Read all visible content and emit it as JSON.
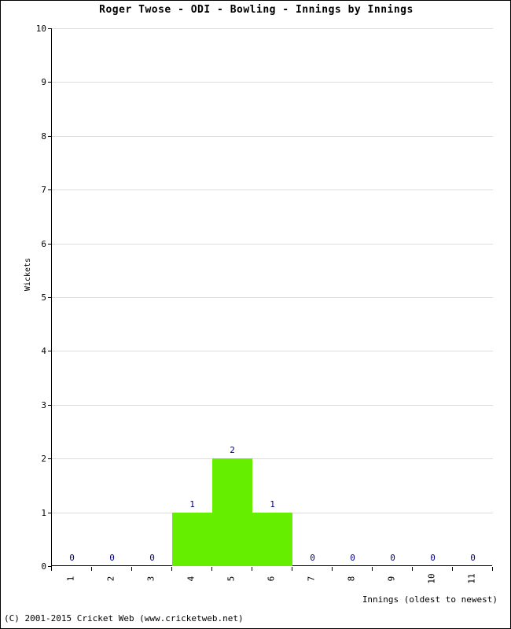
{
  "title": "Roger Twose - ODI - Bowling - Innings by Innings",
  "footer": "(C) 2001-2015 Cricket Web (www.cricketweb.net)",
  "axes": {
    "y_title": "Wickets",
    "x_title": "Innings (oldest to newest)",
    "y_ticks": [
      "0",
      "1",
      "2",
      "3",
      "4",
      "5",
      "6",
      "7",
      "8",
      "9",
      "10"
    ],
    "x_ticks": [
      "1",
      "2",
      "3",
      "4",
      "5",
      "6",
      "7",
      "8",
      "9",
      "10",
      "11"
    ]
  },
  "colors": {
    "bar": "#66ee00",
    "grid": "#dcdcdc",
    "axis": "#000000",
    "value_label": "#000080"
  },
  "chart_data": {
    "type": "bar",
    "title": "Roger Twose - ODI - Bowling - Innings by Innings",
    "xlabel": "Innings (oldest to newest)",
    "ylabel": "Wickets",
    "categories": [
      "1",
      "2",
      "3",
      "4",
      "5",
      "6",
      "7",
      "8",
      "9",
      "10",
      "11"
    ],
    "values": [
      0,
      0,
      0,
      1,
      2,
      1,
      0,
      0,
      0,
      0,
      0
    ],
    "value_labels": [
      "0",
      "0",
      "0",
      "1",
      "2",
      "1",
      "0",
      "0",
      "0",
      "0",
      "0"
    ],
    "ylim": [
      0,
      10
    ],
    "ytick_interval": 1,
    "grid": true,
    "legend": false,
    "series": [
      {
        "name": "Wickets",
        "values": [
          0,
          0,
          0,
          1,
          2,
          1,
          0,
          0,
          0,
          0,
          0
        ]
      }
    ]
  }
}
